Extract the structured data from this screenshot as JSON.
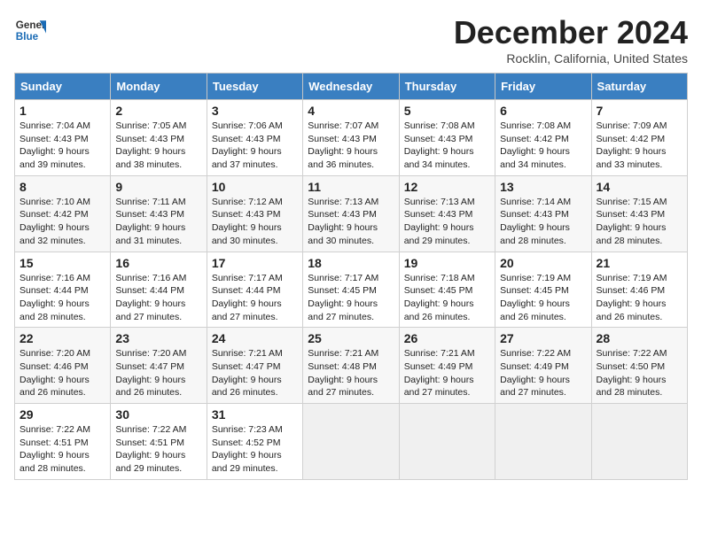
{
  "header": {
    "logo_general": "General",
    "logo_blue": "Blue",
    "title": "December 2024",
    "subtitle": "Rocklin, California, United States"
  },
  "columns": [
    "Sunday",
    "Monday",
    "Tuesday",
    "Wednesday",
    "Thursday",
    "Friday",
    "Saturday"
  ],
  "weeks": [
    [
      {
        "day": "1",
        "sunrise": "7:04 AM",
        "sunset": "4:43 PM",
        "daylight": "9 hours and 39 minutes."
      },
      {
        "day": "2",
        "sunrise": "7:05 AM",
        "sunset": "4:43 PM",
        "daylight": "9 hours and 38 minutes."
      },
      {
        "day": "3",
        "sunrise": "7:06 AM",
        "sunset": "4:43 PM",
        "daylight": "9 hours and 37 minutes."
      },
      {
        "day": "4",
        "sunrise": "7:07 AM",
        "sunset": "4:43 PM",
        "daylight": "9 hours and 36 minutes."
      },
      {
        "day": "5",
        "sunrise": "7:08 AM",
        "sunset": "4:43 PM",
        "daylight": "9 hours and 34 minutes."
      },
      {
        "day": "6",
        "sunrise": "7:08 AM",
        "sunset": "4:42 PM",
        "daylight": "9 hours and 34 minutes."
      },
      {
        "day": "7",
        "sunrise": "7:09 AM",
        "sunset": "4:42 PM",
        "daylight": "9 hours and 33 minutes."
      }
    ],
    [
      {
        "day": "8",
        "sunrise": "7:10 AM",
        "sunset": "4:42 PM",
        "daylight": "9 hours and 32 minutes."
      },
      {
        "day": "9",
        "sunrise": "7:11 AM",
        "sunset": "4:43 PM",
        "daylight": "9 hours and 31 minutes."
      },
      {
        "day": "10",
        "sunrise": "7:12 AM",
        "sunset": "4:43 PM",
        "daylight": "9 hours and 30 minutes."
      },
      {
        "day": "11",
        "sunrise": "7:13 AM",
        "sunset": "4:43 PM",
        "daylight": "9 hours and 30 minutes."
      },
      {
        "day": "12",
        "sunrise": "7:13 AM",
        "sunset": "4:43 PM",
        "daylight": "9 hours and 29 minutes."
      },
      {
        "day": "13",
        "sunrise": "7:14 AM",
        "sunset": "4:43 PM",
        "daylight": "9 hours and 28 minutes."
      },
      {
        "day": "14",
        "sunrise": "7:15 AM",
        "sunset": "4:43 PM",
        "daylight": "9 hours and 28 minutes."
      }
    ],
    [
      {
        "day": "15",
        "sunrise": "7:16 AM",
        "sunset": "4:44 PM",
        "daylight": "9 hours and 28 minutes."
      },
      {
        "day": "16",
        "sunrise": "7:16 AM",
        "sunset": "4:44 PM",
        "daylight": "9 hours and 27 minutes."
      },
      {
        "day": "17",
        "sunrise": "7:17 AM",
        "sunset": "4:44 PM",
        "daylight": "9 hours and 27 minutes."
      },
      {
        "day": "18",
        "sunrise": "7:17 AM",
        "sunset": "4:45 PM",
        "daylight": "9 hours and 27 minutes."
      },
      {
        "day": "19",
        "sunrise": "7:18 AM",
        "sunset": "4:45 PM",
        "daylight": "9 hours and 26 minutes."
      },
      {
        "day": "20",
        "sunrise": "7:19 AM",
        "sunset": "4:45 PM",
        "daylight": "9 hours and 26 minutes."
      },
      {
        "day": "21",
        "sunrise": "7:19 AM",
        "sunset": "4:46 PM",
        "daylight": "9 hours and 26 minutes."
      }
    ],
    [
      {
        "day": "22",
        "sunrise": "7:20 AM",
        "sunset": "4:46 PM",
        "daylight": "9 hours and 26 minutes."
      },
      {
        "day": "23",
        "sunrise": "7:20 AM",
        "sunset": "4:47 PM",
        "daylight": "9 hours and 26 minutes."
      },
      {
        "day": "24",
        "sunrise": "7:21 AM",
        "sunset": "4:47 PM",
        "daylight": "9 hours and 26 minutes."
      },
      {
        "day": "25",
        "sunrise": "7:21 AM",
        "sunset": "4:48 PM",
        "daylight": "9 hours and 27 minutes."
      },
      {
        "day": "26",
        "sunrise": "7:21 AM",
        "sunset": "4:49 PM",
        "daylight": "9 hours and 27 minutes."
      },
      {
        "day": "27",
        "sunrise": "7:22 AM",
        "sunset": "4:49 PM",
        "daylight": "9 hours and 27 minutes."
      },
      {
        "day": "28",
        "sunrise": "7:22 AM",
        "sunset": "4:50 PM",
        "daylight": "9 hours and 28 minutes."
      }
    ],
    [
      {
        "day": "29",
        "sunrise": "7:22 AM",
        "sunset": "4:51 PM",
        "daylight": "9 hours and 28 minutes."
      },
      {
        "day": "30",
        "sunrise": "7:22 AM",
        "sunset": "4:51 PM",
        "daylight": "9 hours and 29 minutes."
      },
      {
        "day": "31",
        "sunrise": "7:23 AM",
        "sunset": "4:52 PM",
        "daylight": "9 hours and 29 minutes."
      },
      null,
      null,
      null,
      null
    ]
  ]
}
